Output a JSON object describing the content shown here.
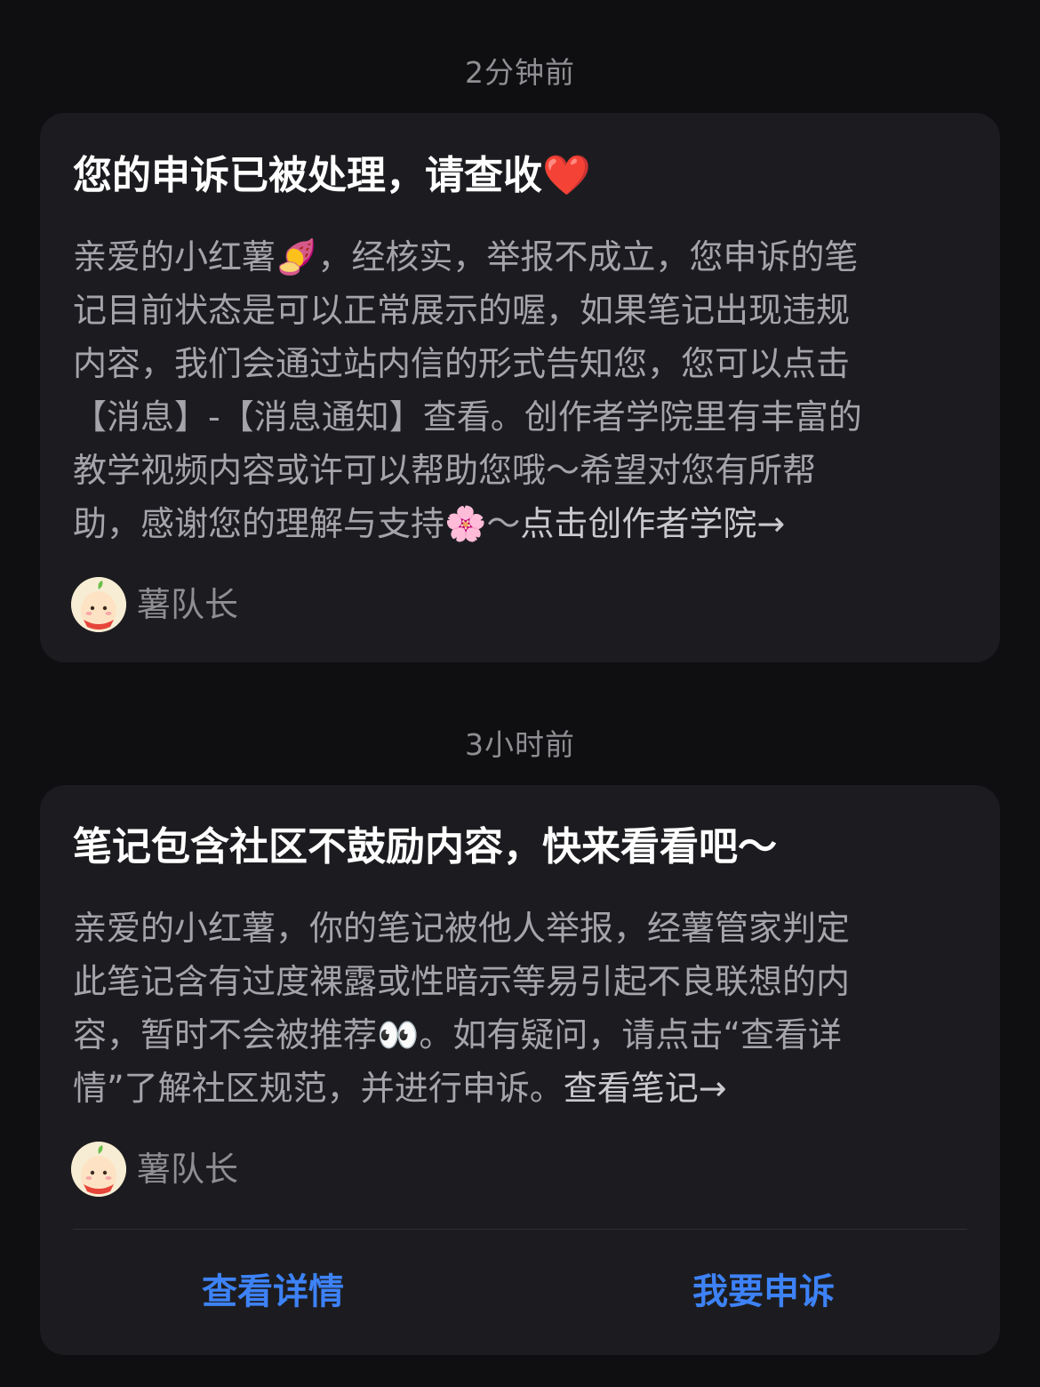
{
  "notifications": [
    {
      "time": "2分钟前",
      "title": "您的申诉已被处理，请查收❤️",
      "body_lines": [
        "亲爱的小红薯🍠，经核实，举报不成立，您申诉的笔",
        "记目前状态是可以正常展示的喔，如果笔记出现违规",
        "内容，我们会通过站内信的形式告知您，您可以点击",
        "【消息】-【消息通知】查看。创作者学院里有丰富的",
        "教学视频内容或许可以帮助您哦～希望对您有所帮",
        "助，感谢您的理解与支持🌸～"
      ],
      "link": "点击创作者学院→",
      "sender": "薯队长"
    },
    {
      "time": "3小时前",
      "title": "笔记包含社区不鼓励内容，快来看看吧～",
      "body_lines": [
        "亲爱的小红薯，你的笔记被他人举报，经薯管家判定",
        "此笔记含有过度裸露或性暗示等易引起不良联想的内",
        "容，暂时不会被推荐👀。如有疑问，请点击“查看详",
        "情”了解社区规范，并进行申诉。"
      ],
      "link": "查看笔记→",
      "sender": "薯队长",
      "actions": {
        "details": "查看详情",
        "appeal": "我要申诉"
      }
    }
  ],
  "colors": {
    "background": "#0f0f11",
    "card": "#1c1c20",
    "action_blue": "#3d82f6",
    "muted_text": "#8e8e93"
  },
  "icons": {
    "avatar": "potato-mascot-avatar-icon"
  }
}
